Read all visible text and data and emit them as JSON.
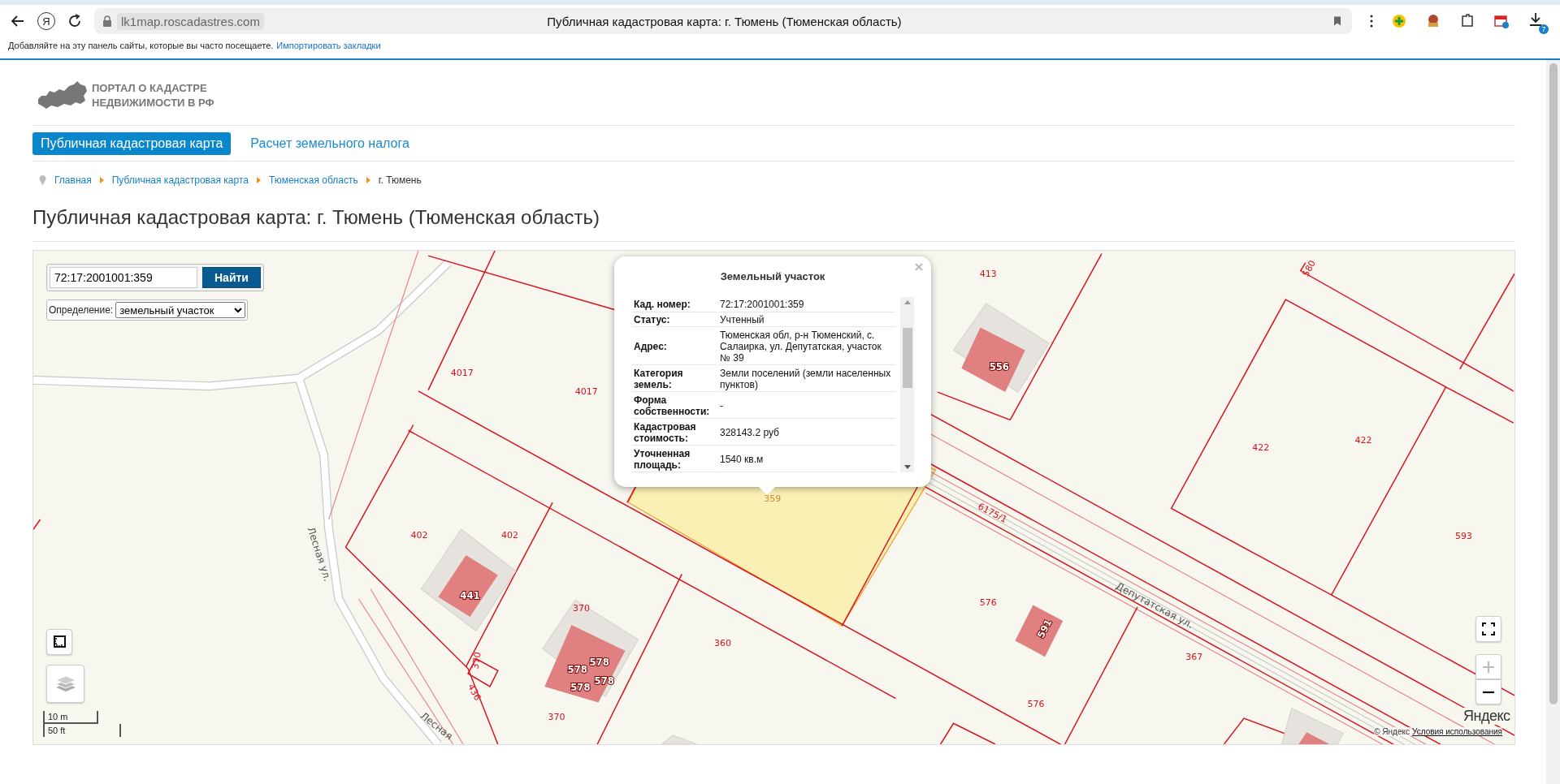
{
  "browser": {
    "logo": "Я",
    "url": "lk1map.roscadastres.com",
    "title": "Публичная кадастровая карта: г. Тюмень (Тюменская область)",
    "download_count": "7",
    "bookmarks_hint": "Добавляйте на эту панель сайты, которые вы часто посещаете.",
    "bookmarks_link": "Импортировать закладки"
  },
  "header": {
    "logo_lines": [
      "ПОРТАЛ О КАДАСТРЕ",
      "НЕДВИЖИМОСТИ В РФ"
    ]
  },
  "nav": [
    {
      "label": "Публичная кадастровая карта",
      "selected": true
    },
    {
      "label": "Расчет земельного налога",
      "selected": false
    }
  ],
  "breadcrumbs": [
    {
      "label": "Главная",
      "link": true
    },
    {
      "label": "Публичная кадастровая карта",
      "link": true
    },
    {
      "label": "Тюменская область",
      "link": true
    },
    {
      "label": "г. Тюмень",
      "link": false
    }
  ],
  "heading": "Публичная кадастровая карта: г. Тюмень (Тюменская область)",
  "map": {
    "search": {
      "value": "72:17:2001001:359",
      "button": "Найти"
    },
    "definition": {
      "label": "Определение:",
      "value": "земельный участок"
    },
    "popup": {
      "title": "Земельный участок",
      "rows": [
        {
          "label": "Кад. номер:",
          "value": "72:17:2001001:359"
        },
        {
          "label": "Статус:",
          "value": "Учтенный"
        },
        {
          "label": "Адрес:",
          "value": "Тюменская обл, р-н Тюменский, с. Салаирка, ул. Депутатская, участок № 39"
        },
        {
          "label": "Категория земель:",
          "value": "Земли поселений (земли населенных пунктов)"
        },
        {
          "label": "Форма собственности:",
          "value": "-"
        },
        {
          "label": "Кадастровая стоимость:",
          "value": "328143.2 руб"
        },
        {
          "label": "Уточненная площадь:",
          "value": "1540 кв.м"
        }
      ]
    },
    "labels": [
      {
        "kind": "parcel",
        "text": "413"
      },
      {
        "kind": "parcel",
        "text": "580"
      },
      {
        "kind": "parcel",
        "text": "4017"
      },
      {
        "kind": "building",
        "text": "556"
      },
      {
        "kind": "parcel",
        "text": "4017"
      },
      {
        "kind": "parcel",
        "text": "422"
      },
      {
        "kind": "parcel",
        "text": "422"
      },
      {
        "kind": "selected",
        "text": "359"
      },
      {
        "kind": "parcel",
        "text": "6175/1"
      },
      {
        "kind": "street",
        "text": "Лесная ул."
      },
      {
        "kind": "parcel",
        "text": "402"
      },
      {
        "kind": "parcel",
        "text": "402"
      },
      {
        "kind": "parcel",
        "text": "593"
      },
      {
        "kind": "building",
        "text": "441"
      },
      {
        "kind": "parcel",
        "text": "370"
      },
      {
        "kind": "parcel",
        "text": "576"
      },
      {
        "kind": "street",
        "text": "Депутатская ул."
      },
      {
        "kind": "building",
        "text": "591"
      },
      {
        "kind": "parcel",
        "text": "370"
      },
      {
        "kind": "building",
        "text": "578"
      },
      {
        "kind": "building",
        "text": "578"
      },
      {
        "kind": "parcel",
        "text": "360"
      },
      {
        "kind": "parcel",
        "text": "367"
      },
      {
        "kind": "parcel",
        "text": "436"
      },
      {
        "kind": "building",
        "text": "578"
      },
      {
        "kind": "building",
        "text": "578"
      },
      {
        "kind": "parcel",
        "text": "576"
      },
      {
        "kind": "street",
        "text": "Лесная"
      },
      {
        "kind": "parcel",
        "text": "370"
      }
    ],
    "zoom": [
      {
        "kind": "in",
        "disabled": true
      },
      {
        "kind": "out",
        "disabled": false
      }
    ],
    "scale": [
      "10 m",
      "50 ft"
    ],
    "logo": "Яндекс",
    "attribution": "© Яндекс",
    "terms_link": "Условия использования"
  }
}
